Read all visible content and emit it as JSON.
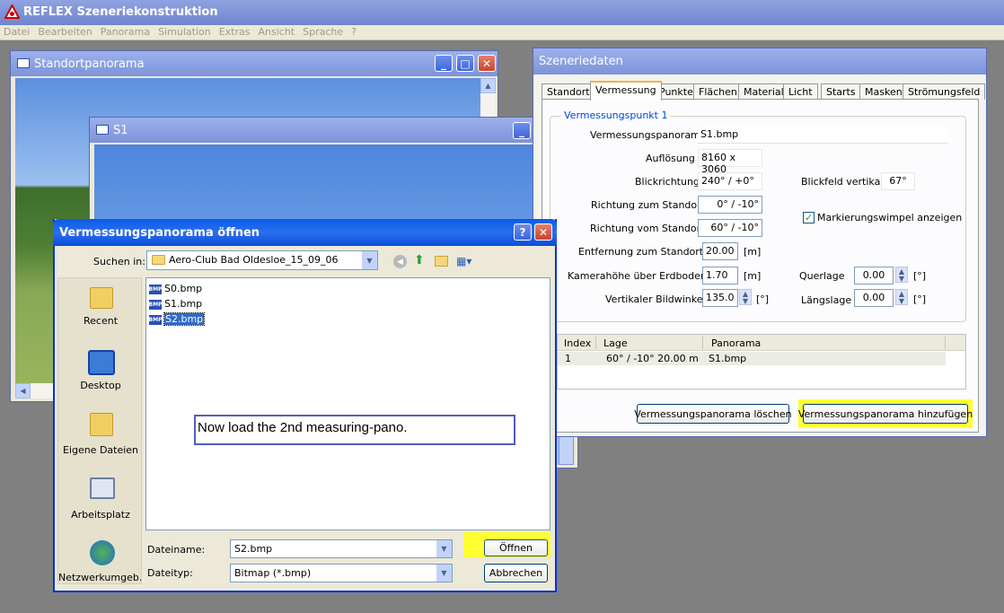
{
  "app": {
    "title": "REFLEX Szeneriekonstruktion",
    "menu": [
      "Datei",
      "Bearbeiten",
      "Panorama",
      "Simulation",
      "Extras",
      "Ansicht",
      "Sprache",
      "?"
    ]
  },
  "standort_window": {
    "title": "Standortpanorama"
  },
  "s1_window": {
    "title": "S1"
  },
  "szenerie": {
    "title": "Szeneriedaten",
    "tabs": [
      "Standort",
      "Vermessung",
      "Punkte",
      "Flächen",
      "Material",
      "Licht",
      "Starts",
      "Masken",
      "Strömungsfeld"
    ],
    "active_tab": "Vermessung",
    "group_title": "Vermessungspunkt 1",
    "fields": {
      "pano_label": "Vermessungspanorama",
      "pano_value": "S1.bmp",
      "res_label": "Auflösung",
      "res_value": "8160 x 3060",
      "dir_label": "Blickrichtung",
      "dir_value": "240° /   +0°",
      "fov_label": "Blickfeld vertikal",
      "fov_value": "67°",
      "to_label": "Richtung zum Standort",
      "to_value": "0° /  -10°",
      "from_label": "Richtung vom Standort",
      "from_value": "60° /  -10°",
      "dist_label": "Entfernung zum Standort",
      "dist_value": "20.00",
      "dist_unit": "[m]",
      "cam_label": "Kamerahöhe über Erdboden",
      "cam_value": "1.70",
      "cam_unit": "[m]",
      "vang_label": "Vertikaler Bildwinkel",
      "vang_value": "135.0",
      "vang_unit": "[°]",
      "quer_label": "Querlage",
      "quer_value": "0.00",
      "quer_unit": "[°]",
      "laengs_label": "Längslage",
      "laengs_value": "0.00",
      "laengs_unit": "[°]",
      "checkbox_label": "Markierungswimpel anzeigen"
    },
    "table": {
      "headers": [
        "Index",
        "Lage",
        "Panorama"
      ],
      "rows": [
        {
          "index": "1",
          "lage": "60° /  -10°    20.00 m",
          "panorama": "S1.bmp"
        }
      ]
    },
    "btn_delete": "Vermessungspanorama löschen",
    "btn_add": "Vermessungspanorama hinzufügen"
  },
  "dialog": {
    "title": "Vermessungspanorama öffnen",
    "lookin_label": "Suchen in:",
    "lookin_value": "Aero-Club Bad Oldesloe_15_09_06",
    "places": [
      "Recent",
      "Desktop",
      "Eigene Dateien",
      "Arbeitsplatz",
      "Netzwerkumgeb..."
    ],
    "files": [
      {
        "badge": "BMP",
        "name": "S0.bmp"
      },
      {
        "badge": "BMP",
        "name": "S1.bmp"
      },
      {
        "badge": "BMP",
        "name": "S2.bmp"
      }
    ],
    "annotation": "Now load the 2nd measuring-pano.",
    "filename_label": "Dateiname:",
    "filename_value": "S2.bmp",
    "filetype_label": "Dateityp:",
    "filetype_value": "Bitmap (*.bmp)",
    "open_button": "Öffnen",
    "cancel_button": "Abbrechen"
  }
}
